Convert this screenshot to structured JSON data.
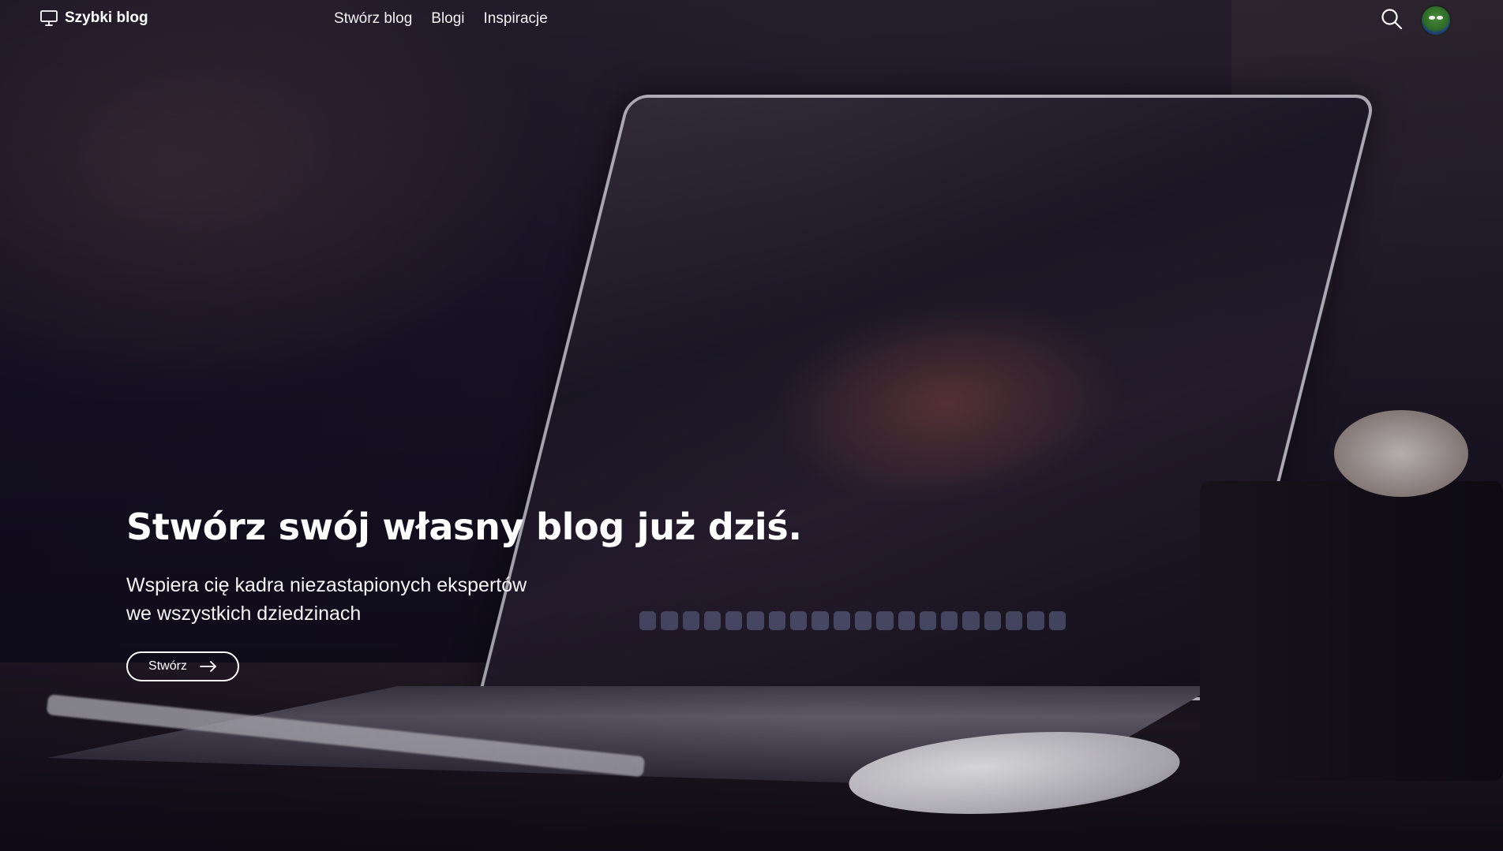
{
  "navbar": {
    "brand_name": "Szybki blog",
    "brand_icon": "monitor-icon",
    "links": [
      {
        "label": "Stwórz blog"
      },
      {
        "label": "Blogi"
      },
      {
        "label": "Inspiracje"
      }
    ],
    "search_icon": "search-icon",
    "avatar_icon": "user-avatar"
  },
  "hero": {
    "title": "Stwórz swój własny blog już dziś.",
    "subtitle_line1": "Wspiera cię kadra niezastapionych ekspertów",
    "subtitle_line2": "we wszystkich dziedzinach",
    "cta_label": "Stwórz",
    "cta_icon": "arrow-right-icon"
  },
  "colors": {
    "text": "#ffffff",
    "background_dark": "#140f1f",
    "button_border": "#ffffff"
  }
}
